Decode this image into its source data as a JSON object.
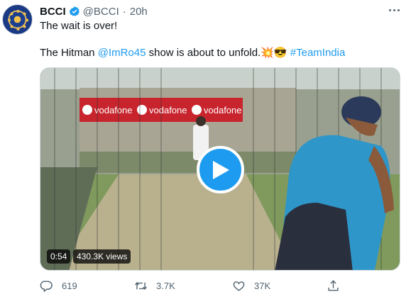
{
  "tweet": {
    "author_name": "BCCI",
    "author_handle": "@BCCI",
    "separator": "·",
    "time": "20h",
    "text_line1": "The wait is over!",
    "text_line2_prefix": "The Hitman ",
    "mention": "@ImRo45",
    "text_line2_middle": " show is about to unfold.",
    "emojis": "💥😎",
    "hashtag": "#TeamIndia"
  },
  "media": {
    "duration": "0:54",
    "views": "430.3K views",
    "banner_text": "vodafone"
  },
  "actions": {
    "reply_count": "619",
    "retweet_count": "3.7K",
    "like_count": "37K"
  },
  "icons": [
    "verified-badge-icon",
    "more-options-icon",
    "play-icon",
    "reply-icon",
    "retweet-icon",
    "like-icon",
    "share-icon"
  ],
  "colors": {
    "accent": "#1d9bf0",
    "secondary_text": "#536471",
    "banner": "#c8242d"
  }
}
